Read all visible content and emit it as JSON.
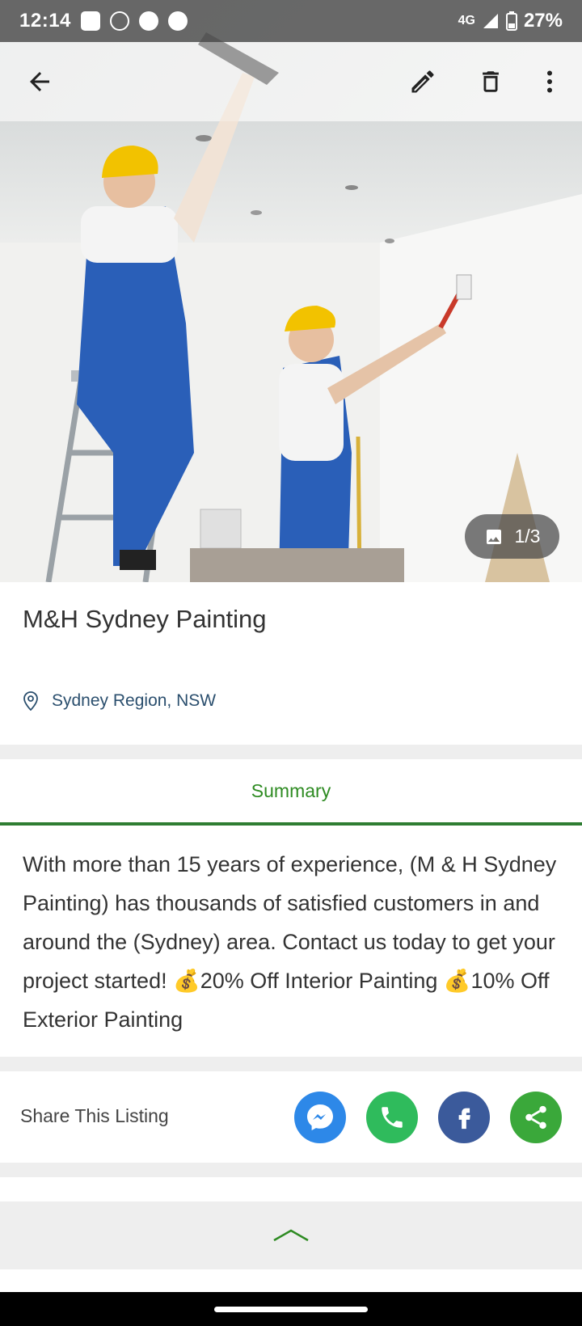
{
  "status_bar": {
    "time": "12:14",
    "network": "4G",
    "battery": "27%"
  },
  "app_bar": {
    "back_icon": "arrow-left-icon",
    "edit_icon": "pencil-icon",
    "delete_icon": "trash-icon",
    "more_icon": "more-vert-icon"
  },
  "gallery": {
    "counter": "1/3",
    "counter_icon": "image-icon"
  },
  "listing": {
    "title": "M&H Sydney Painting",
    "location": "Sydney Region, NSW"
  },
  "tabs": {
    "active": "Summary"
  },
  "summary": {
    "text": "With more than 15 years of experience, (M & H Sydney Painting) has thousands of satisfied customers in and around the (Sydney) area. Contact us today to get your project started! 💰20% Off Interior Painting 💰10% Off Exterior Painting"
  },
  "share": {
    "label": "Share This Listing",
    "buttons": [
      {
        "name": "messenger",
        "color": "#2d88e8"
      },
      {
        "name": "whatsapp",
        "color": "#2fbb5c"
      },
      {
        "name": "facebook",
        "color": "#3b5a9b"
      },
      {
        "name": "share",
        "color": "#3aa83a"
      }
    ]
  },
  "colors": {
    "accent_green": "#2e7d32",
    "tab_text_green": "#2e8b22",
    "location_blue": "#2b4f6e"
  }
}
